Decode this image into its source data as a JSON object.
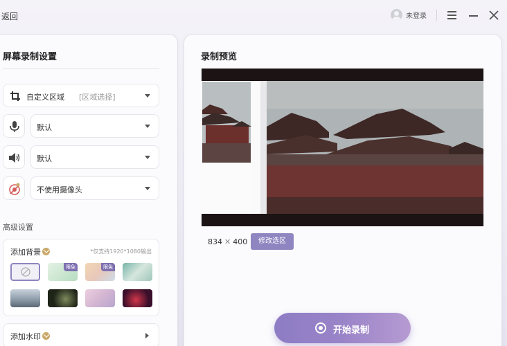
{
  "topbar": {
    "back_label": "返回",
    "user_label": "未登录",
    "icons": [
      "user-avatar",
      "menu-icon",
      "minimize-icon",
      "close-icon"
    ]
  },
  "left_panel": {
    "title": "屏幕录制设置",
    "area": {
      "label": "自定义区域",
      "hint": "[区域选择]",
      "icon": "crop-icon"
    },
    "microphone": {
      "value": "默认",
      "icon": "microphone-icon"
    },
    "speaker": {
      "value": "默认",
      "icon": "speaker-icon"
    },
    "camera": {
      "value": "不使用摄像头",
      "icon": "camera-off-icon"
    },
    "advanced_label": "高级设置",
    "background": {
      "title": "添加背景",
      "note": "*仅支持1920*1080输出",
      "free_tag": "限免",
      "thumbnails": [
        "none",
        "mint-gradient",
        "peach-gradient",
        "teal-abstract",
        "mountains",
        "dark-forest",
        "pink-mist",
        "red-purple-glow"
      ]
    },
    "watermark": {
      "title": "添加水印"
    }
  },
  "right_panel": {
    "title": "录制预览",
    "resolution_w": "834",
    "resolution_sep": "✕",
    "resolution_h": "400",
    "modify_label": "修改选区",
    "start_label": "开始录制"
  },
  "colors": {
    "accent": "#8f85c0",
    "start_gradient_from": "#8d7cc4",
    "start_gradient_to": "#b69bd2",
    "vip_gold": "#c9a96a"
  }
}
